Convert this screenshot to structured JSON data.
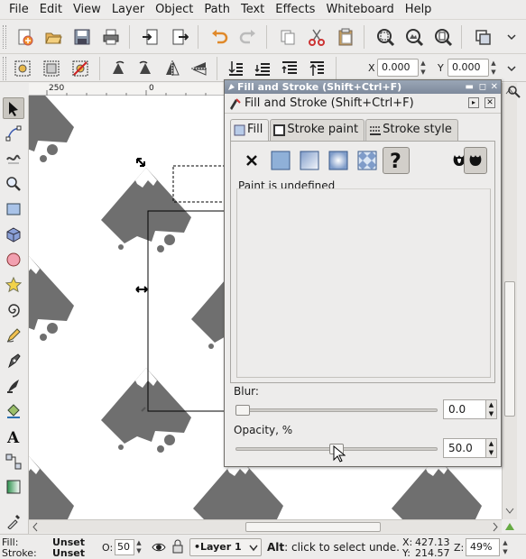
{
  "menubar": {
    "items": [
      "File",
      "Edit",
      "View",
      "Layer",
      "Object",
      "Path",
      "Text",
      "Effects",
      "Whiteboard",
      "Help"
    ],
    "underlines": [
      "F",
      "E",
      "V",
      "L",
      "O",
      "P",
      "T",
      "c",
      "W",
      "H"
    ]
  },
  "toolbar": {
    "x_label": "X",
    "x_value": "0.000",
    "y_label": "Y",
    "y_value": "0.000"
  },
  "ruler": {
    "tick_minus250": "250",
    "tick_0": "0"
  },
  "dialog": {
    "window_title": "Fill and Stroke (Shift+Ctrl+F)",
    "header_title": "Fill and Stroke (Shift+Ctrl+F)",
    "tabs": [
      "Fill",
      "Stroke paint",
      "Stroke style"
    ],
    "paint_status": "Paint is undefined",
    "blur_label": "Blur:",
    "blur_value": "0.0",
    "blur_level": 0.0,
    "opacity_label": "Opacity, %",
    "opacity_value": "50.0",
    "opacity_level": 0.5
  },
  "status": {
    "fill_label": "Fill:",
    "fill_value": "Unset",
    "stroke_label": "Stroke:",
    "stroke_value": "Unset",
    "o_label": "O:",
    "o_value": "50",
    "layer": "•Layer 1",
    "hint_key": "Alt",
    "hint_text": ": click to select unde.",
    "x_label": "X:",
    "x_value": "427.13",
    "y_label": "Y:",
    "y_value": "214.57",
    "zoom_label": "Z:",
    "zoom_value": "49%"
  },
  "colors": {
    "blob": "#6f6f6f",
    "selection": "#000000"
  }
}
